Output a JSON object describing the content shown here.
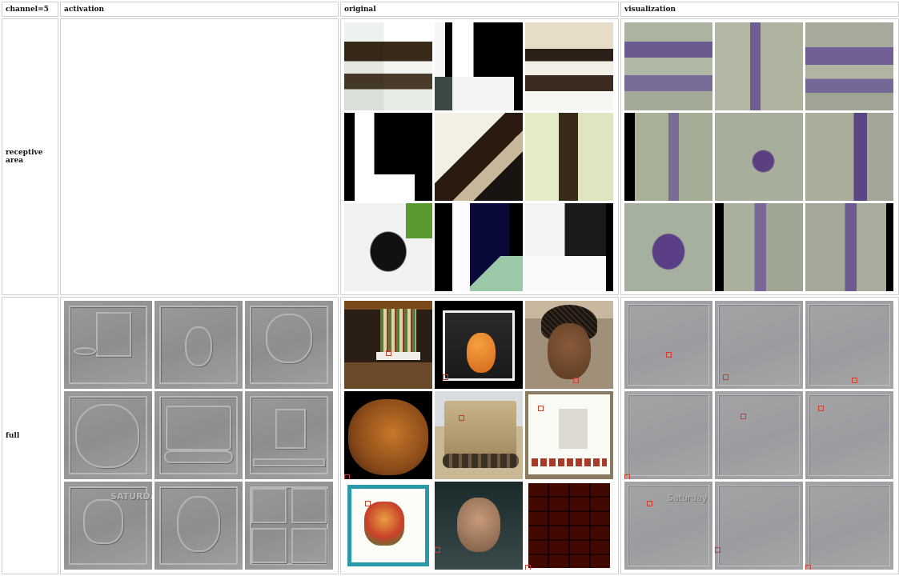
{
  "header": {
    "channel": "channel=5",
    "activation": "activation",
    "original": "original",
    "visualization": "visualization"
  },
  "rows": {
    "receptive": "receptive area",
    "full": "full"
  },
  "activation_tiles": {
    "card_text": "SATURDAY"
  },
  "visualization_tiles": {
    "card_text": "Saturday"
  }
}
